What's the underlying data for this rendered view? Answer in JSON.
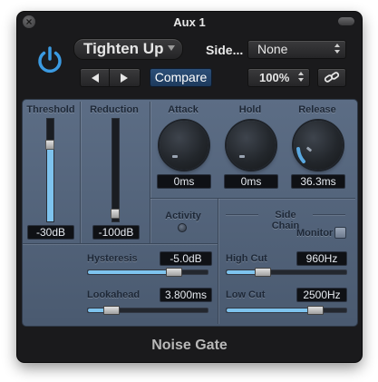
{
  "window": {
    "title": "Aux 1",
    "close_glyph": "×"
  },
  "header": {
    "preset": "Tighten Up",
    "side_label": "Side...",
    "side_value": "None",
    "compare_label": "Compare",
    "zoom_value": "100%",
    "power_color": "#3b9ae1"
  },
  "threshold": {
    "label": "Threshold",
    "value": "-30dB",
    "fill_fraction": 0.75
  },
  "reduction": {
    "label": "Reduction",
    "value": "-100dB",
    "handle_fraction": 0.08
  },
  "knobs": [
    {
      "key": "attack",
      "label": "Attack",
      "value": "0ms"
    },
    {
      "key": "hold",
      "label": "Hold",
      "value": "0ms"
    },
    {
      "key": "release",
      "label": "Release",
      "value": "36.3ms"
    }
  ],
  "activity": {
    "label": "Activity"
  },
  "hysteresis": {
    "label": "Hysteresis",
    "value": "-5.0dB",
    "fraction": 0.72
  },
  "lookahead": {
    "label": "Lookahead",
    "value": "3.800ms",
    "fraction": 0.2
  },
  "side_chain": {
    "label": "Side Chain",
    "monitor_label": "Monitor",
    "high_cut": {
      "label": "High Cut",
      "value": "960Hz",
      "fraction": 0.3
    },
    "low_cut": {
      "label": "Low Cut",
      "value": "2500Hz",
      "fraction": 0.74
    }
  },
  "footer": {
    "plugin_name": "Noise Gate"
  },
  "colors": {
    "accent": "#7ec3ee",
    "panel": "#56677e",
    "window": "#1a1a1c"
  }
}
